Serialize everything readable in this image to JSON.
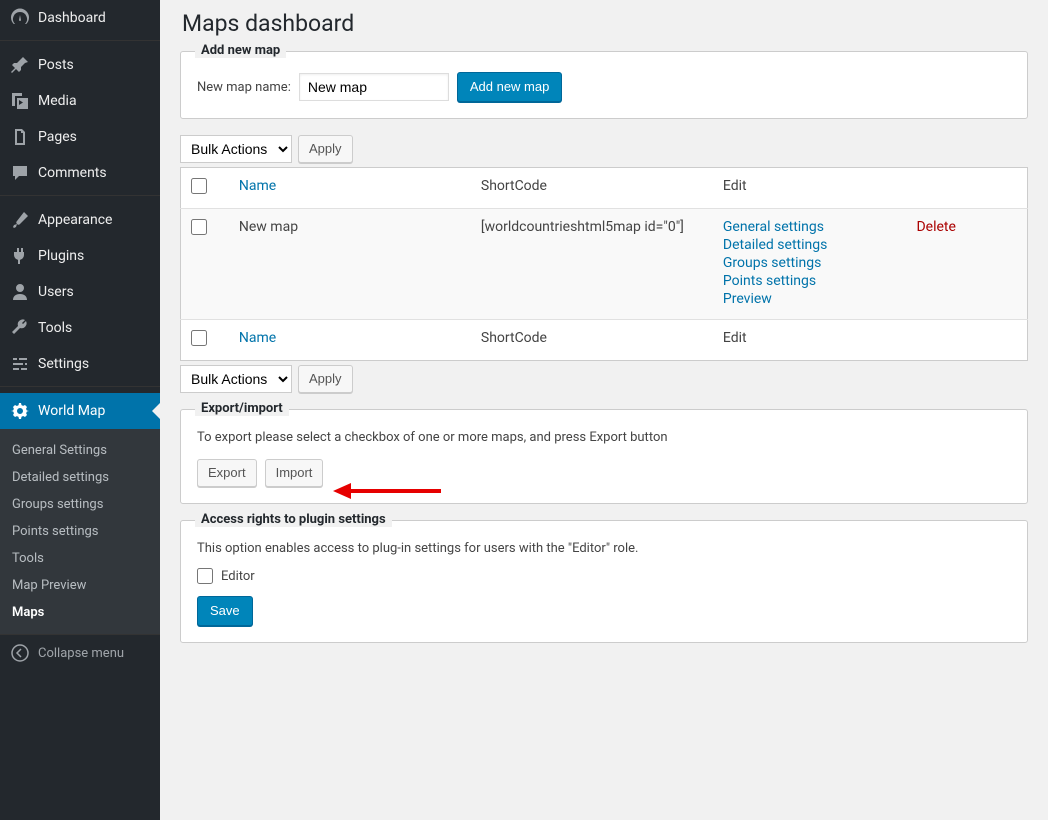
{
  "sidebar": {
    "items": [
      {
        "label": "Dashboard"
      },
      {
        "label": "Posts"
      },
      {
        "label": "Media"
      },
      {
        "label": "Pages"
      },
      {
        "label": "Comments"
      },
      {
        "label": "Appearance"
      },
      {
        "label": "Plugins"
      },
      {
        "label": "Users"
      },
      {
        "label": "Tools"
      },
      {
        "label": "Settings"
      },
      {
        "label": "World Map"
      }
    ],
    "sub_items": [
      {
        "label": "General Settings"
      },
      {
        "label": "Detailed settings"
      },
      {
        "label": "Groups settings"
      },
      {
        "label": "Points settings"
      },
      {
        "label": "Tools"
      },
      {
        "label": "Map Preview"
      },
      {
        "label": "Maps"
      }
    ],
    "collapse_label": "Collapse menu"
  },
  "page": {
    "title": "Maps dashboard"
  },
  "add_box": {
    "title": "Add new map",
    "label": "New map name:",
    "input_value": "New map",
    "button_label": "Add new map"
  },
  "bulk": {
    "select_label": "Bulk Actions",
    "apply_label": "Apply"
  },
  "table": {
    "columns": {
      "name": "Name",
      "shortcode": "ShortCode",
      "edit": "Edit"
    },
    "rows": [
      {
        "name": "New map",
        "shortcode": "[worldcountrieshtml5map id=\"0\"]",
        "edit_links": [
          "General settings",
          "Detailed settings",
          "Groups settings",
          "Points settings",
          "Preview"
        ],
        "action": "Delete"
      }
    ]
  },
  "export_box": {
    "title": "Export/import",
    "desc": "To export please select a checkbox of one or more maps, and press Export button",
    "export_label": "Export",
    "import_label": "Import"
  },
  "access_box": {
    "title": "Access rights to plugin settings",
    "desc": "This option enables access to plug-in settings for users with the \"Editor\" role.",
    "checkbox_label": "Editor",
    "save_label": "Save"
  }
}
